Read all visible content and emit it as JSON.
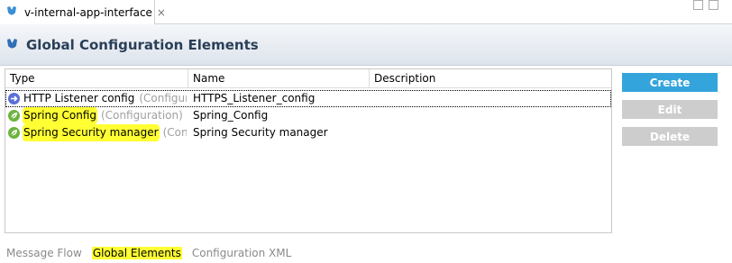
{
  "editor_tab": {
    "title": "v-internal-app-interface",
    "close_symbol": "×"
  },
  "header": {
    "title": "Global Configuration Elements"
  },
  "table": {
    "columns": [
      "Type",
      "Name",
      "Description"
    ],
    "rows": [
      {
        "type_name": "HTTP Listener config",
        "type_kind": "(Configuration)",
        "name": "HTTPS_Listener_config",
        "description": "",
        "icon": "http-listener-icon",
        "highlighted": false,
        "selected": true
      },
      {
        "type_name": "Spring Config",
        "type_kind": "(Configuration)",
        "name": "Spring_Config",
        "description": "",
        "icon": "spring-leaf-icon",
        "highlighted": true,
        "selected": false
      },
      {
        "type_name": "Spring Security manager",
        "type_kind": "(Configuration)",
        "name": "Spring Security manager",
        "description": "",
        "icon": "spring-leaf-icon",
        "highlighted": true,
        "selected": false
      }
    ]
  },
  "buttons": {
    "create": "Create",
    "edit": "Edit",
    "delete": "Delete"
  },
  "bottom_tabs": [
    {
      "label": "Message Flow",
      "active": false
    },
    {
      "label": "Global Elements",
      "active": true
    },
    {
      "label": "Configuration XML",
      "active": false
    }
  ],
  "colors": {
    "accent": "#34a4dc",
    "highlight": "#ffff33",
    "header_text": "#2a3f58"
  }
}
